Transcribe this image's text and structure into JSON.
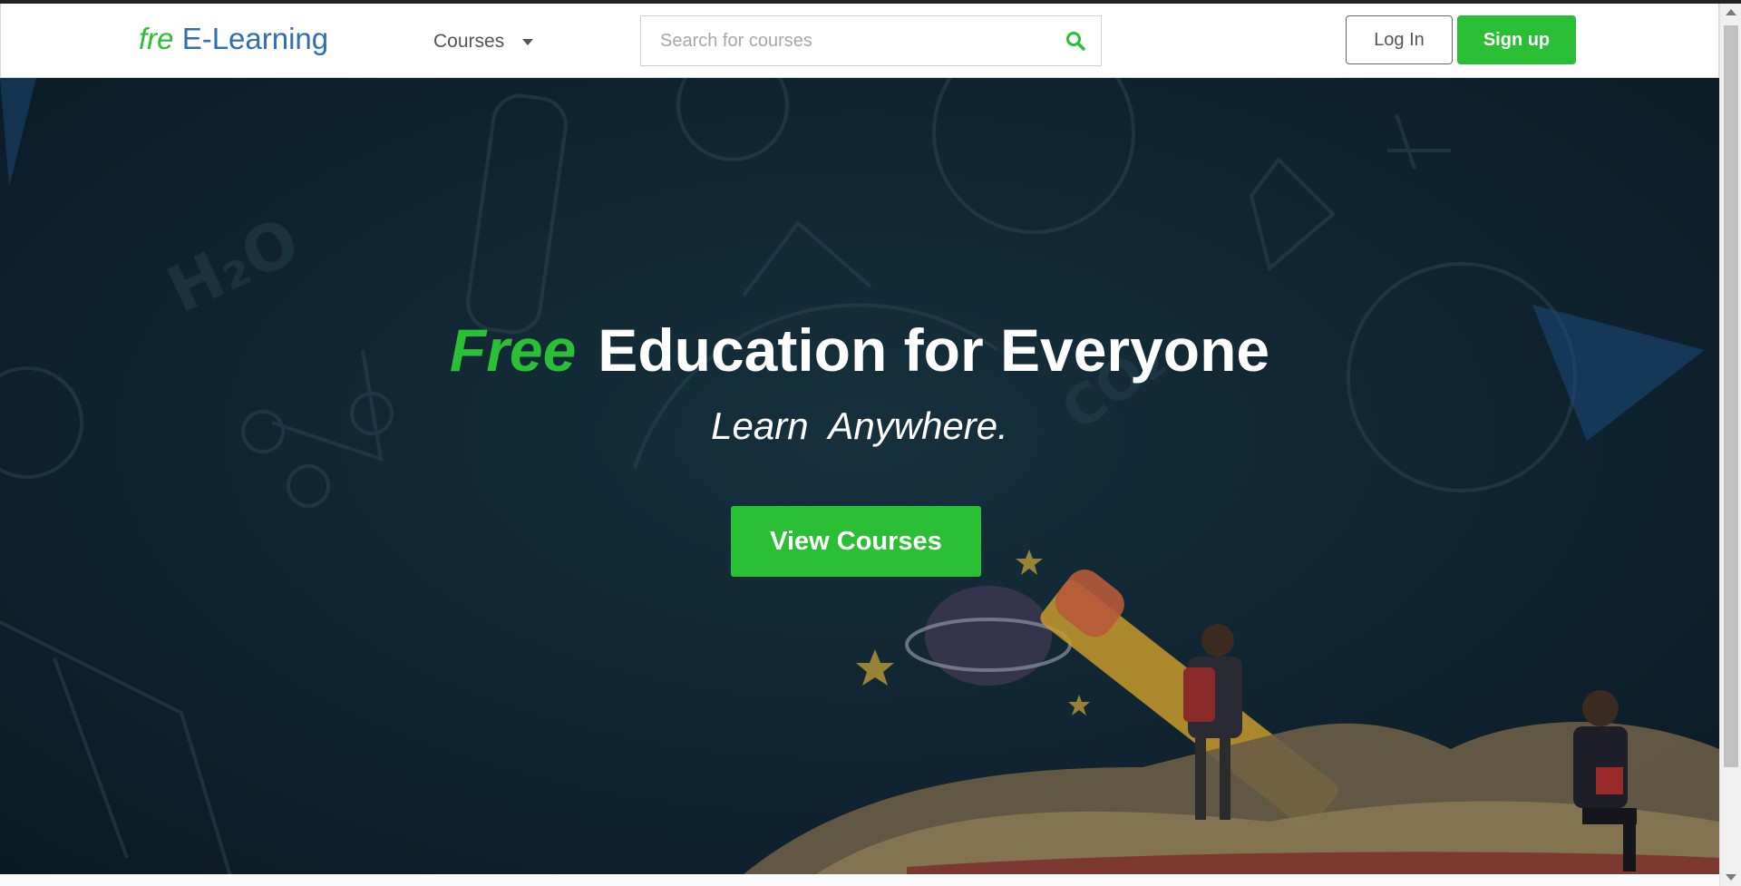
{
  "navbar": {
    "logo_prefix": "fre",
    "logo_main": "E-Learning",
    "courses_label": "Courses",
    "search_placeholder": "Search for courses",
    "search_value": "",
    "login_label": "Log In",
    "signup_label": "Sign up"
  },
  "hero": {
    "headline_emphasis": "Free",
    "headline_rest": "Education for Everyone",
    "subheadline": "Learn  Anywhere.",
    "cta_label": "View Courses"
  },
  "icons": {
    "search": "search-icon",
    "courses_caret": "caret-down-icon"
  },
  "colors": {
    "accent_green": "#2bbf35",
    "brand_blue": "#2f6fb8",
    "hero_background": "#0f2430"
  }
}
